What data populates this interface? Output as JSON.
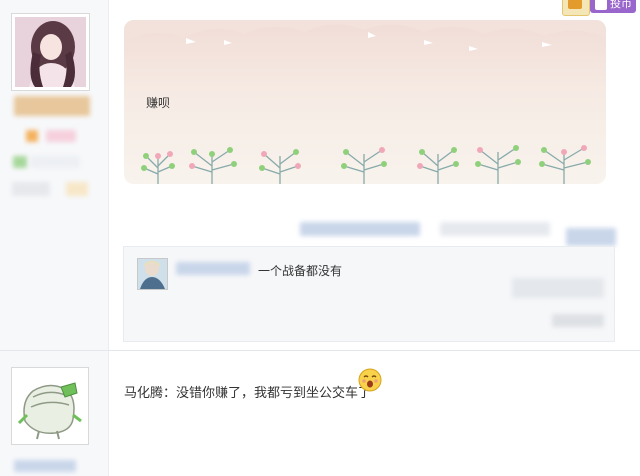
{
  "post": {
    "text": "赚呗"
  },
  "quote": {
    "text": "一个战备都没有"
  },
  "reply": {
    "author": "马化腾",
    "separator": "：",
    "text": "没错你赚了，我都亏到坐公交车了"
  },
  "badges": {
    "tip_label": "投币"
  },
  "colors": {
    "card_bg": "#f8f3ed",
    "card_top": "#f1dcd6",
    "tree_green": "#8fd17a",
    "tree_pink": "#f0a8b8",
    "blur_blue": "#c9d6ea",
    "blur_orange": "#f4b25f"
  },
  "icons": {
    "emoji": "shy-surprised-emoji-icon",
    "avatar_top": "user-avatar-girl",
    "avatar_bottom": "user-avatar-cartoon",
    "quote_avatar": "user-avatar-small"
  }
}
